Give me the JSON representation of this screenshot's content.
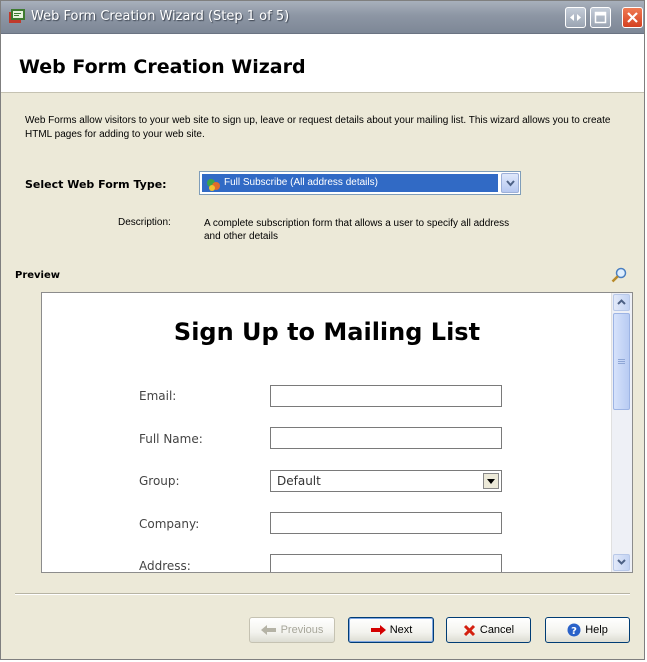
{
  "window": {
    "title": "Web Form Creation Wizard (Step 1 of 5)",
    "controls": [
      "restore-icon",
      "maximize-icon",
      "close-icon"
    ]
  },
  "header": {
    "title": "Web Form Creation Wizard"
  },
  "intro": {
    "text": "Web Forms allow visitors to your web site to sign up, leave or request details about your mailing list. This wizard allows you to create HTML pages for adding to your web site."
  },
  "form_type": {
    "label": "Select Web Form Type:",
    "selected": "Full Subscribe (All address details)",
    "description_label": "Description:",
    "description": "A complete subscription form that allows a user to specify all address and other details"
  },
  "preview": {
    "label": "Preview",
    "heading": "Sign Up to Mailing List",
    "fields": [
      {
        "label": "Email:",
        "type": "text",
        "value": ""
      },
      {
        "label": "Full Name:",
        "type": "text",
        "value": ""
      },
      {
        "label": "Group:",
        "type": "select",
        "value": "Default"
      },
      {
        "label": "Company:",
        "type": "text",
        "value": ""
      },
      {
        "label": "Address:",
        "type": "text",
        "value": ""
      }
    ]
  },
  "buttons": {
    "previous": "Previous",
    "next": "Next",
    "cancel": "Cancel",
    "help": "Help"
  },
  "colors": {
    "selection": "#316ac5",
    "dialog_bg": "#ece9d8",
    "next_arrow": "#d40000",
    "cancel_x": "#d42010",
    "help_icon": "#2a62c9"
  }
}
